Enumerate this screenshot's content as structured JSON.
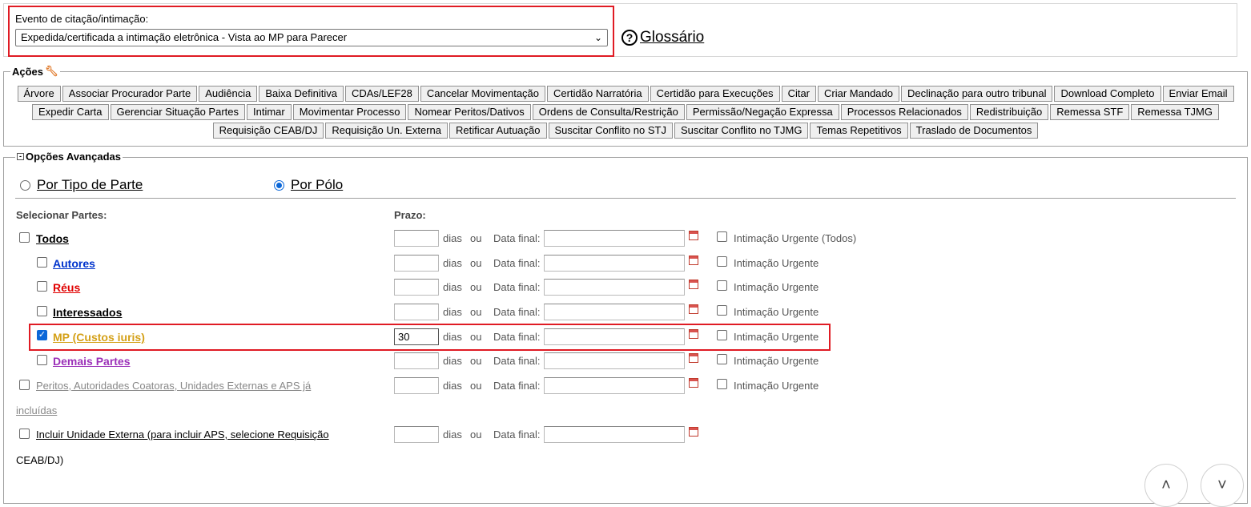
{
  "event": {
    "label": "Evento de citação/intimação:",
    "selected": "Expedida/certificada a intimação eletrônica - Vista ao MP para Parecer",
    "glossary": "Glossário"
  },
  "acoes": {
    "legend": "Ações",
    "rows": [
      [
        "Árvore",
        "Associar Procurador Parte",
        "Audiência",
        "Baixa Definitiva",
        "CDAs/LEF28",
        "Cancelar Movimentação",
        "Certidão Narratória",
        "Certidão para Execuções",
        "Citar",
        "Criar Mandado",
        "Declinação para outro tribunal",
        "Download Completo",
        "Enviar Email"
      ],
      [
        "Expedir Carta",
        "Gerenciar Situação Partes",
        "Intimar",
        "Movimentar Processo",
        "Nomear Peritos/Dativos",
        "Ordens de Consulta/Restrição",
        "Permissão/Negação Expressa",
        "Processos Relacionados",
        "Redistribuição",
        "Remessa STF",
        "Remessa TJMG"
      ],
      [
        "Requisição CEAB/DJ",
        "Requisição Un. Externa",
        "Retificar Autuação",
        "Suscitar Conflito no STJ",
        "Suscitar Conflito no TJMG",
        "Temas Repetitivos",
        "Traslado de Documentos"
      ]
    ]
  },
  "advanced": {
    "legend": "Opções Avançadas",
    "radio_tipo": "Por Tipo de Parte",
    "radio_polo": "Por Pólo",
    "selected_radio": "Por Pólo",
    "header_partes": "Selecionar Partes:",
    "header_prazo": "Prazo:",
    "dias": "dias",
    "ou": "ou",
    "data_final": "Data final:",
    "parties": [
      {
        "name": "Todos",
        "checked": false,
        "prazo": "",
        "urgent": "Intimação Urgente (Todos)",
        "color": "#000000"
      },
      {
        "name": "Autores",
        "checked": false,
        "prazo": "",
        "urgent": "Intimação Urgente",
        "color": "#0033cc"
      },
      {
        "name": "Réus",
        "checked": false,
        "prazo": "",
        "urgent": "Intimação Urgente",
        "color": "#e00000"
      },
      {
        "name": "Interessados",
        "checked": false,
        "prazo": "",
        "urgent": "Intimação Urgente",
        "color": "#000000"
      },
      {
        "name": "MP (Custos iuris)",
        "checked": true,
        "prazo": "30",
        "urgent": "Intimação Urgente",
        "color": "#d4a017"
      },
      {
        "name": "Demais Partes",
        "checked": false,
        "prazo": "",
        "urgent": "Intimação Urgente",
        "color": "#9b30b8"
      },
      {
        "name_line1": "Peritos, Autoridades Coatoras, Unidades Externas e APS já",
        "name_line2": "incluídas",
        "checked": false,
        "prazo": "",
        "urgent": "Intimação Urgente",
        "color": "#888888"
      },
      {
        "name_line1": "Incluir Unidade Externa (para incluir APS, selecione Requisição",
        "name_line2": "CEAB/DJ)",
        "checked": false,
        "prazo": "",
        "color": "#000000"
      }
    ]
  },
  "icons": [
    "help-icon",
    "wrench-icon",
    "collapse-icon",
    "calendar-icon",
    "chevron-up-icon",
    "chevron-down-icon"
  ]
}
